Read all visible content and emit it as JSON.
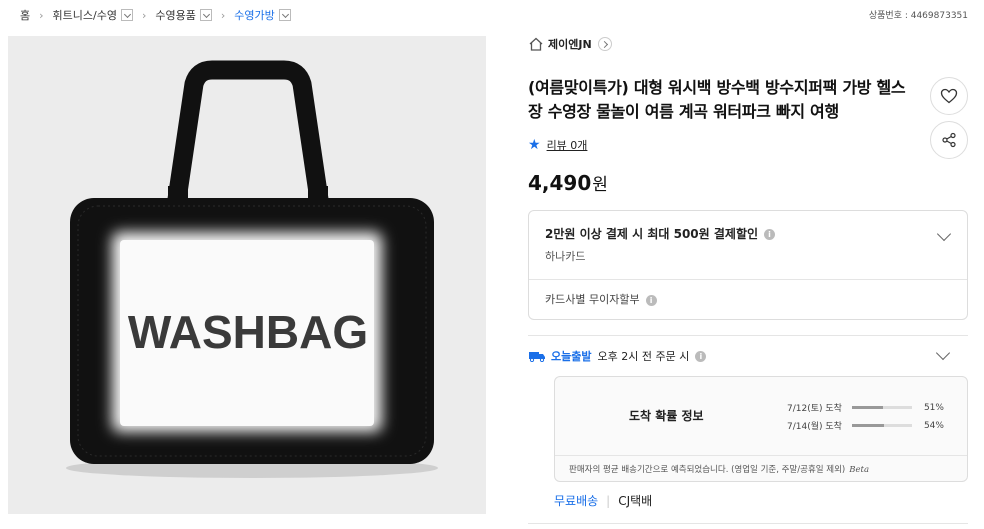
{
  "breadcrumb": {
    "items": [
      {
        "label": "홈",
        "dropdown": false
      },
      {
        "label": "휘트니스/수영",
        "dropdown": true
      },
      {
        "label": "수영용품",
        "dropdown": true
      },
      {
        "label": "수영가방",
        "dropdown": true,
        "current": true
      }
    ]
  },
  "product_number": "상품번호 : 4469873351",
  "image": {
    "bag_text": "WASHBAG"
  },
  "seller": {
    "name": "제이엔JN"
  },
  "title": "(여름맞이특가) 대형 워시백 방수백 방수지퍼팩 가방 헬스장 수영장 물놀이 여름 계곡 워터파크 빠지 여행",
  "review": {
    "label": "리뷰 0개"
  },
  "price": {
    "amount": "4,490",
    "unit": "원"
  },
  "benefit": {
    "discount": "2만원 이상 결제 시 최대 500원 결제할인",
    "card": "하나카드",
    "installment": "카드사별 무이자할부"
  },
  "delivery": {
    "badge": "오늘출발",
    "text": "오후 2시 전 주문 시",
    "probability_heading": "도착 확률 정보",
    "rows": [
      {
        "date": "7/12(토) 도착",
        "percent": "51%",
        "value": 51
      },
      {
        "date": "7/14(월) 도착",
        "percent": "54%",
        "value": 54
      }
    ],
    "note": "판매자의 평균 배송기간으로 예측되었습니다. (영업일 기준, 주말/공휴일 제외)",
    "beta": "Beta"
  },
  "shipping": {
    "free": "무료배송",
    "courier": "CJ택배"
  },
  "colors": {
    "accent": "#1a6fe8",
    "bag": "#111111"
  },
  "icons": [
    "home-icon",
    "chevron-right-icon",
    "heart-icon",
    "share-icon",
    "star-icon",
    "info-icon",
    "chevron-down-icon",
    "truck-icon"
  ]
}
